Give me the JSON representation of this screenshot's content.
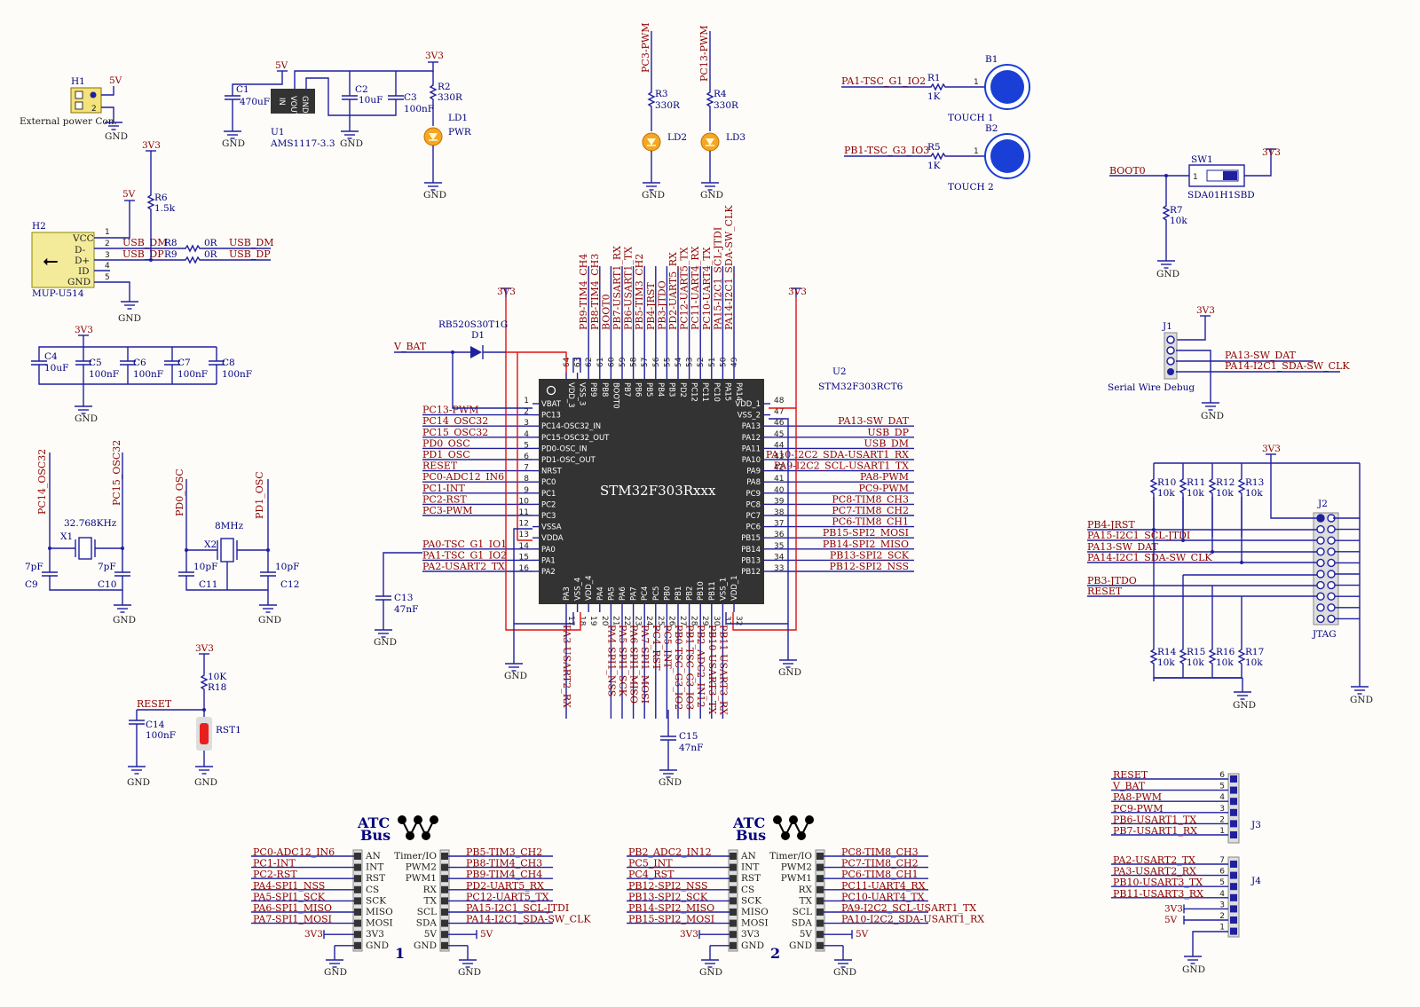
{
  "colors": {
    "wire": "#1f1fa0",
    "power_wire": "#e01010",
    "net_label": "#8b0000",
    "chip": "#333333",
    "led": "#f5a623",
    "touch_pad": "#1a3fd6"
  },
  "power": {
    "h1": {
      "ref": "H1",
      "desc": "External power Con.",
      "p5v": "5V",
      "gnd": "GND",
      "pin2": "2"
    },
    "u1": {
      "ref": "U1",
      "part": "AMS1117-3.3",
      "pins": [
        "IN",
        "VOUT",
        "GND"
      ],
      "p5v": "5V",
      "p3v3": "3V3",
      "gnd1": "GND",
      "gnd2": "GND"
    },
    "c1": {
      "ref": "C1",
      "val": "470uF"
    },
    "c2": {
      "ref": "C2",
      "val": "10uF"
    },
    "c3": {
      "ref": "C3",
      "val": "100nF"
    },
    "r2": {
      "ref": "R2",
      "val": "330R"
    },
    "ld1": {
      "ref": "LD1",
      "val": "PWR"
    },
    "gnd3": "GND"
  },
  "leds": {
    "r3": {
      "ref": "R3",
      "val": "330R",
      "net": "PC3-PWM"
    },
    "r4": {
      "ref": "R4",
      "val": "330R",
      "net": "PC13-PWM"
    },
    "ld2": "LD2",
    "ld3": "LD3",
    "gnd": "GND"
  },
  "touch": {
    "b1": {
      "ref": "B1",
      "name": "TOUCH 1",
      "net": "PA1-TSC_G1_IO2",
      "r": "R1",
      "val": "1K",
      "pin": "1"
    },
    "b2": {
      "ref": "B2",
      "name": "TOUCH 2",
      "net": "PB1-TSC_G3_IO3",
      "r": "R5",
      "val": "1K",
      "pin": "1"
    }
  },
  "boot": {
    "net": "BOOT0",
    "sw": "SW1",
    "part": "SDA01H1SBD",
    "pin": "1",
    "r": "R7",
    "val": "10k",
    "p3v3": "3V3",
    "gnd": "GND"
  },
  "usb": {
    "ref": "H2",
    "part": "MUP-U514",
    "pins": [
      "VCC",
      "D-",
      "D+",
      "ID",
      "GND"
    ],
    "nums": [
      "1",
      "2",
      "3",
      "4",
      "5"
    ],
    "r6": {
      "ref": "R6",
      "val": "1.5k"
    },
    "p3v3": "3V3",
    "p5v": "5V",
    "r8": "R8",
    "r9": "R9",
    "r_val": "0R",
    "dm": "USB_DM",
    "dp": "USB_DP",
    "gnd": "GND"
  },
  "decoupling": {
    "p3v3": "3V3",
    "caps": [
      {
        "ref": "C4",
        "val": "10uF"
      },
      {
        "ref": "C5",
        "val": "100nF"
      },
      {
        "ref": "C6",
        "val": "100nF"
      },
      {
        "ref": "C7",
        "val": "100nF"
      },
      {
        "ref": "C8",
        "val": "100nF"
      }
    ],
    "gnd": "GND"
  },
  "crystal32": {
    "ref": "X1",
    "val": "32.768KHz",
    "n1": "PC14_OSC32",
    "n2": "PC15_OSC32",
    "c9": "C9",
    "c10": "C10",
    "cval": "7pF",
    "gnd": "GND"
  },
  "crystal8": {
    "ref": "X2",
    "val": "8MHz",
    "n1": "PD0_OSC",
    "n2": "PD1_OSC",
    "c11": "C11",
    "c12": "C12",
    "cval": "10pF",
    "gnd": "GND"
  },
  "reset": {
    "net": "RESET",
    "p3v3": "3V3",
    "r": "R18",
    "val": "10K",
    "c": "C14",
    "cval": "100nF",
    "sw": "RST1",
    "gnd": "GND"
  },
  "mcu": {
    "ref": "U2",
    "part": "STM32F303RCT6",
    "title": "STM32F303Rxxx",
    "d1": "D1",
    "diode": "RB520S30T1G",
    "vbat": "V_BAT",
    "p3v3a": "3V3",
    "p3v3b": "3V3",
    "gnd1": "GND",
    "gnd2": "GND",
    "gnd3": "GND",
    "c13": "C13",
    "c13val": "47nF",
    "c15": "C15",
    "c15val": "47nF",
    "left": [
      [
        "1",
        "VBAT",
        ""
      ],
      [
        "2",
        "PC13",
        "PC13-PWM"
      ],
      [
        "3",
        "PC14-OSC32_IN",
        "PC14_OSC32"
      ],
      [
        "4",
        "PC15-OSC32_OUT",
        "PC15_OSC32"
      ],
      [
        "5",
        "PD0-OSC_IN",
        "PD0_OSC"
      ],
      [
        "6",
        "PD1-OSC_OUT",
        "PD1_OSC"
      ],
      [
        "7",
        "NRST",
        "RESET"
      ],
      [
        "8",
        "PC0",
        "PC0-ADC12_IN6"
      ],
      [
        "9",
        "PC1",
        "PC1-INT"
      ],
      [
        "10",
        "PC2",
        "PC2-RST"
      ],
      [
        "11",
        "PC3",
        "PC3-PWM"
      ],
      [
        "12",
        "VSSA",
        ""
      ],
      [
        "13",
        "VDDA",
        ""
      ],
      [
        "14",
        "PA0",
        "PA0-TSC_G1_IO1"
      ],
      [
        "15",
        "PA1",
        "PA1-TSC_G1_IO2"
      ],
      [
        "16",
        "PA2",
        "PA2-USART2_TX"
      ]
    ],
    "right": [
      [
        "48",
        "VDD_1",
        ""
      ],
      [
        "47",
        "VSS_2",
        ""
      ],
      [
        "46",
        "PA13",
        "PA13-SW_DAT"
      ],
      [
        "45",
        "PA12",
        "USB_DP"
      ],
      [
        "44",
        "PA11",
        "USB_DM"
      ],
      [
        "43",
        "PA10",
        "PA10-I2C2_SDA-USART1_RX"
      ],
      [
        "42",
        "PA9",
        "PA9-I2C2_SCL-USART1_TX"
      ],
      [
        "41",
        "PA8",
        "PA8-PWM"
      ],
      [
        "40",
        "PC9",
        "PC9-PWM"
      ],
      [
        "39",
        "PC8",
        "PC8-TIM8_CH3"
      ],
      [
        "38",
        "PC7",
        "PC7-TIM8_CH2"
      ],
      [
        "37",
        "PC6",
        "PC6-TIM8_CH1"
      ],
      [
        "36",
        "PB15",
        "PB15-SPI2_MOSI"
      ],
      [
        "35",
        "PB14",
        "PB14-SPI2_MISO"
      ],
      [
        "34",
        "PB13",
        "PB13-SPI2_SCK"
      ],
      [
        "33",
        "PB12",
        "PB12-SPI2_NSS"
      ]
    ],
    "top": [
      [
        "64",
        "VDD_3",
        ""
      ],
      [
        "63",
        "VSS_3",
        ""
      ],
      [
        "62",
        "PB9",
        "PB9-TIM4_CH4"
      ],
      [
        "61",
        "PB8",
        "PB8-TIM4_CH3"
      ],
      [
        "60",
        "BOOT0",
        "BOOT0"
      ],
      [
        "59",
        "PB7",
        "PB7-USART1_RX"
      ],
      [
        "58",
        "PB6",
        "PB6-USART1_TX"
      ],
      [
        "57",
        "PB5",
        "PB5-TIM3_CH2"
      ],
      [
        "56",
        "PB4",
        "PB4-JRST"
      ],
      [
        "55",
        "PB3",
        "PB3-JTDO"
      ],
      [
        "54",
        "PD2",
        "PD2-UART5_RX"
      ],
      [
        "53",
        "PC12",
        "PC12-UART5_TX"
      ],
      [
        "52",
        "PC11",
        "PC11-UART4_RX"
      ],
      [
        "51",
        "PC10",
        "PC10-UART4_TX"
      ],
      [
        "50",
        "PA15",
        "PA15-I2C1_SCL-JTDI"
      ],
      [
        "49",
        "PA14",
        "PA14-I2C1_SDA-SW_CLK"
      ]
    ],
    "bottom": [
      [
        "17",
        "PA3",
        "PA3-USART2_RX"
      ],
      [
        "18",
        "VSS_4",
        ""
      ],
      [
        "19",
        "VDD_4",
        ""
      ],
      [
        "20",
        "PA4",
        ""
      ],
      [
        "21",
        "PA5",
        "PA4-SPI1_NSS"
      ],
      [
        "22",
        "PA6",
        "PA5-SPI1_SCK"
      ],
      [
        "23",
        "PA7",
        "PA6-SPI1_MISO"
      ],
      [
        "24",
        "PC4",
        "PA7-SPI1_MOSI"
      ],
      [
        "25",
        "PC5",
        "PC4_RST"
      ],
      [
        "26",
        "PB0",
        "PC5_INT"
      ],
      [
        "27",
        "PB1",
        "PB0-TSC_G3_IO2"
      ],
      [
        "28",
        "PB2",
        "PB1-TSC_G3_IO3"
      ],
      [
        "29",
        "PB10",
        "PB2_ADC2_IN12"
      ],
      [
        "30",
        "PB11",
        "PB10-USART3_TX"
      ],
      [
        "31",
        "VSS_1",
        "PB11-USART3_RX"
      ],
      [
        "32",
        "VDD_1",
        ""
      ]
    ]
  },
  "swd": {
    "ref": "J1",
    "desc": "Serial Wire Debug",
    "p3v3": "3V3",
    "n1": "PA13-SW_DAT",
    "n2": "PA14-I2C1_SDA-SW_CLK",
    "gnd": "GND"
  },
  "jtag": {
    "ref": "J2",
    "name": "JTAG",
    "p3v3": "3V3",
    "top_r": [
      "R10",
      "R11",
      "R12",
      "R13"
    ],
    "bot_r": [
      "R14",
      "R15",
      "R16",
      "R17"
    ],
    "rval": "10k",
    "nets": [
      "PB4-JRST",
      "PA15-I2C1_SCL-JTDI",
      "PA13-SW_DAT",
      "PA14-I2C1_SDA-SW_CLK",
      "PB3-JTDO",
      "RESET"
    ],
    "gnd1": "GND",
    "gnd2": "GND"
  },
  "j3": {
    "ref": "J3",
    "nets": [
      "RESET",
      "V_BAT",
      "PA8-PWM",
      "PC9-PWM",
      "PB6-USART1_TX",
      "PB7-USART1_RX"
    ],
    "nums": [
      "6",
      "5",
      "4",
      "3",
      "2",
      "1"
    ]
  },
  "j4": {
    "ref": "J4",
    "nets": [
      "PA2-USART2_TX",
      "PA3-USART2_RX",
      "PB10-USART3_TX",
      "PB11-USART3_RX",
      "3V3",
      "5V",
      ""
    ],
    "nums": [
      "7",
      "6",
      "5",
      "4",
      "3",
      "2",
      "1"
    ],
    "gnd": "GND"
  },
  "atc1": {
    "title1": "ATC",
    "title2": "Bus",
    "num": "1",
    "left_pins": [
      "AN",
      "INT",
      "RST",
      "CS",
      "SCK",
      "MISO",
      "MOSI",
      "3V3",
      "GND"
    ],
    "left_nets": [
      "PC0-ADC12_IN6",
      "PC1-INT",
      "PC2-RST",
      "PA4-SPI1_NSS",
      "PA5-SPI1_SCK",
      "PA6-SPI1_MISO",
      "PA7-SPI1_MOSI",
      "3V3",
      ""
    ],
    "right_pins": [
      "Timer/IO",
      "PWM2",
      "PWM1",
      "RX",
      "TX",
      "SCL",
      "SDA",
      "5V",
      "GND"
    ],
    "right_nets": [
      "PB5-TIM3_CH2",
      "PB8-TIM4_CH3",
      "PB9-TIM4_CH4",
      "PD2-UART5_RX",
      "PC12-UART5_TX",
      "PA15-I2C1_SCL-JTDI",
      "PA14-I2C1_SDA-SW_CLK",
      "5V",
      ""
    ],
    "gnd": "GND"
  },
  "atc2": {
    "title1": "ATC",
    "title2": "Bus",
    "num": "2",
    "left_pins": [
      "AN",
      "INT",
      "RST",
      "CS",
      "SCK",
      "MISO",
      "MOSI",
      "3V3",
      "GND"
    ],
    "left_nets": [
      "PB2_ADC2_IN12",
      "PC5_INT",
      "PC4_RST",
      "PB12-SPI2_NSS",
      "PB13-SPI2_SCK",
      "PB14-SPI2_MISO",
      "PB15-SPI2_MOSI",
      "3V3",
      ""
    ],
    "right_pins": [
      "Timer/IO",
      "PWM2",
      "PWM1",
      "RX",
      "TX",
      "SCL",
      "SDA",
      "5V",
      "GND"
    ],
    "right_nets": [
      "PC8-TIM8_CH3",
      "PC7-TIM8_CH2",
      "PC6-TIM8_CH1",
      "PC11-UART4_RX",
      "PC10-UART4_TX",
      "PA9-I2C2_SCL-USART1_TX",
      "PA10-I2C2_SDA-USART1_RX",
      "5V",
      ""
    ],
    "gnd": "GND"
  }
}
